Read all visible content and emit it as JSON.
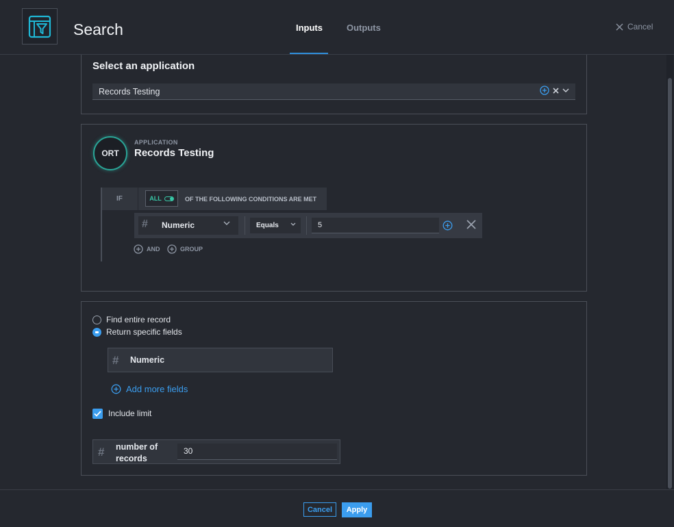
{
  "header": {
    "title": "Search",
    "tabs": [
      {
        "label": "Inputs",
        "active": true
      },
      {
        "label": "Outputs",
        "active": false
      }
    ],
    "cancel_label": "Cancel"
  },
  "application_section": {
    "title": "Select an application",
    "selected_value": "Records Testing"
  },
  "filter_section": {
    "avatar_initials": "ORT",
    "kicker": "APPLICATION",
    "app_name": "Records Testing",
    "if_label": "IF",
    "match_mode": "ALL",
    "conditions_text": "OF THE FOLLOWING CONDITIONS ARE MET",
    "rule": {
      "field": "Numeric",
      "operator": "Equals",
      "value": "5"
    },
    "and_label": "AND",
    "group_label": "GROUP"
  },
  "output_section": {
    "radio_options": [
      {
        "label": "Find entire record",
        "selected": false
      },
      {
        "label": "Return specific fields",
        "selected": true
      }
    ],
    "fields": [
      "Numeric"
    ],
    "add_fields_label": "Add more fields",
    "include_limit_label": "Include limit",
    "include_limit_checked": true,
    "limit_label": "number of records",
    "limit_value": "30"
  },
  "footer": {
    "cancel_label": "Cancel",
    "apply_label": "Apply"
  },
  "colors": {
    "background": "#25282f",
    "accent": "#3b9dee",
    "teal": "#38c9a8",
    "panel_border": "#4b4f58"
  }
}
